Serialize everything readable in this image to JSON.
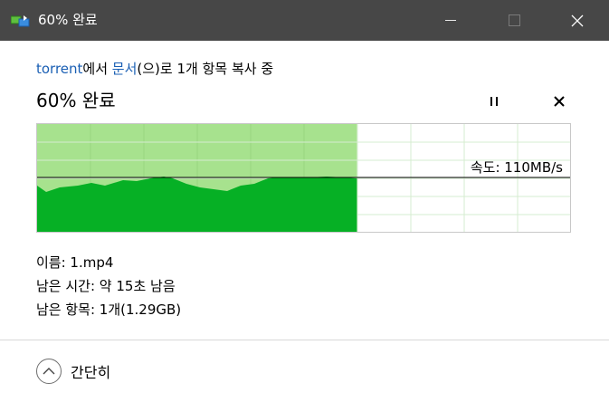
{
  "window": {
    "title": "60% 완료",
    "icon": "file-copy-icon"
  },
  "operation": {
    "source_name": "torrent",
    "from_text": "에서 ",
    "dest_name": "문서",
    "dest_suffix": "(으)로 1개 항목 복사 중",
    "percent_text": "60% 완료",
    "progress_fraction": 0.6
  },
  "speed": {
    "label": "속도: 110MB/s"
  },
  "details": {
    "name": "이름: 1.mp4",
    "time_remaining": "남은 시간: 약 15초 남음",
    "items_remaining": "남은 항목: 1개(1.29GB)"
  },
  "footer": {
    "collapse_label": "간단히"
  },
  "colors": {
    "title_bar": "#474747",
    "link": "#1a5fb4",
    "progress_fill": "#a7e28e",
    "speed_fill": "#06b025",
    "grid": "#c8e8c0"
  }
}
